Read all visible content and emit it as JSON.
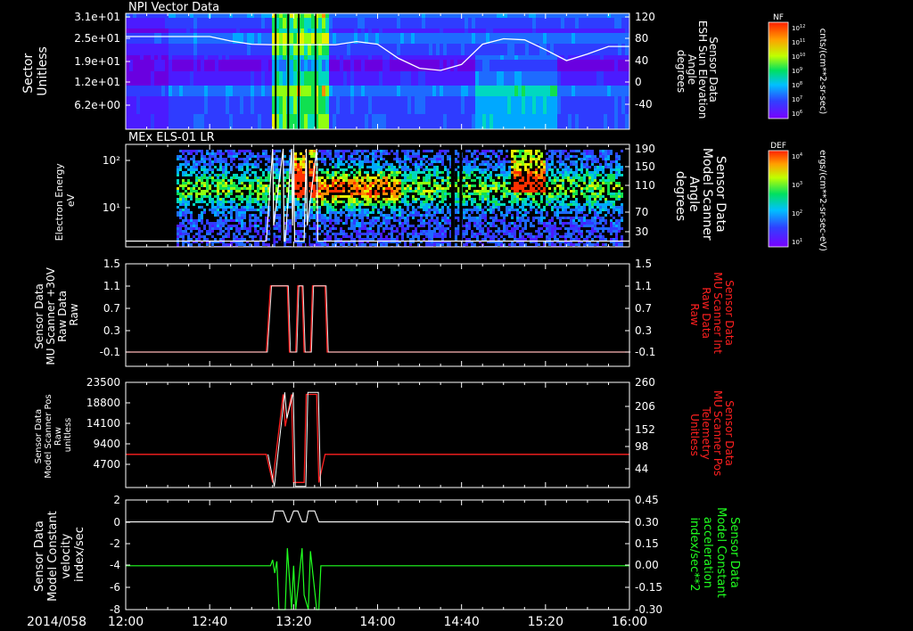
{
  "date_label": "2014/058",
  "time_axis": {
    "ticks": [
      "12:00",
      "12:40",
      "13:20",
      "14:00",
      "14:40",
      "15:20",
      "16:00"
    ]
  },
  "colors": {
    "frame": "#ffffff",
    "red_series": "#ff2020",
    "green_series": "#20ff20",
    "background": "#000000"
  },
  "chart_data": [
    {
      "type": "heatmap",
      "title": "NPI Vector Data",
      "ylabel_left": [
        "Sector",
        "Unitless"
      ],
      "left_ticks": [
        "3.1e+01",
        "2.5e+01",
        "1.9e+01",
        "1.2e+01",
        "6.2e+00"
      ],
      "right_ticks": [
        "120",
        "80",
        "40",
        "0",
        "-40"
      ],
      "ylabel_right": [
        "Sensor Data",
        "ESH Sun Elevation",
        "Angle",
        "degrees"
      ],
      "overlay_series": {
        "name": "Sun Elevation Angle",
        "color": "#ffffff",
        "x_min": [
          0,
          10,
          20,
          30,
          40,
          50,
          60,
          70,
          80,
          90,
          100,
          110,
          120,
          130,
          140,
          150,
          160,
          170,
          180,
          190,
          200,
          210,
          220,
          230,
          240
        ],
        "y_deg": [
          84,
          84,
          84,
          84,
          84,
          76,
          70,
          69,
          69,
          69,
          69,
          75,
          70,
          44,
          26,
          22,
          33,
          70,
          80,
          78,
          60,
          40,
          52,
          66,
          66
        ]
      },
      "colorbar": {
        "title": "NF",
        "tick_labels": [
          "10^12",
          "10^11",
          "10^10",
          "10^9",
          "10^8",
          "10^7",
          "10^6"
        ],
        "units": "cnts/(cm**2-sr-sec)"
      }
    },
    {
      "type": "heatmap",
      "title": "MEx ELS-01 LR",
      "ylabel_left": [
        "Electron Energy",
        "eV"
      ],
      "left_ticks": [
        "10²",
        "10¹"
      ],
      "right_ticks": [
        "190",
        "150",
        "110",
        "70",
        "30"
      ],
      "ylabel_right": [
        "Sensor Data",
        "Model Scanner",
        "Angle",
        "degrees"
      ],
      "overlay_series": {
        "name": "Model Scanner Angle",
        "color": "#ffffff",
        "baseline_deg": 12,
        "max_deg": 190
      },
      "colorbar": {
        "title": "DEF",
        "tick_labels": [
          "10^4",
          "10^3",
          "10^2",
          "10^1"
        ],
        "units": "ergs/(cm**2-sr-sec-eV)"
      }
    },
    {
      "type": "line",
      "ylabel_left": [
        "Sensor Data",
        "MU Scanner +30V",
        "Raw Data",
        "Raw"
      ],
      "left_ticks": [
        "1.5",
        "1.1",
        "0.7",
        "0.3",
        "-0.1"
      ],
      "right_ticks": [
        "1.5",
        "1.1",
        "0.7",
        "0.3",
        "-0.1"
      ],
      "ylabel_right": [
        "Sensor Data",
        "MU Scanner Int",
        "Raw Data",
        "Raw"
      ],
      "ylim": [
        -0.3,
        1.5
      ],
      "series": [
        {
          "name": "MU Scanner Int Raw Data",
          "color": "#ff2020",
          "x": [
            0,
            67,
            69,
            77,
            78,
            81,
            82,
            84,
            85,
            88,
            89,
            95,
            96,
            240
          ],
          "y": [
            0,
            0,
            1,
            1,
            0,
            0,
            1,
            1,
            0,
            0,
            1,
            1,
            0,
            0
          ]
        }
      ],
      "companion_series": {
        "color": "#ffffff",
        "x": [
          0,
          67,
          69,
          77,
          78,
          81,
          82,
          84,
          85,
          88,
          89,
          95,
          96,
          240
        ],
        "y": [
          0,
          0,
          1,
          1,
          0,
          0,
          1,
          1,
          0,
          0,
          1,
          1,
          0,
          0
        ]
      }
    },
    {
      "type": "line",
      "ylabel_left": [
        "Sensor Data",
        "Model Scanner Pos",
        "Raw",
        "unitless"
      ],
      "left_ticks": [
        "23500",
        "18800",
        "14100",
        "9400",
        "4700"
      ],
      "right_ticks": [
        "260",
        "206",
        "152",
        "98",
        "44"
      ],
      "ylabel_right": [
        "Sensor Data",
        "MU Scanner Pos",
        "Telemetry",
        "Unitless"
      ],
      "ylim_left": [
        0,
        23500
      ],
      "ylim_right": [
        -10,
        260
      ],
      "series": [
        {
          "name": "MU Scanner Pos Telemetry",
          "color": "#ff2020",
          "x": [
            0,
            67,
            70,
            75,
            76,
            79,
            80,
            85,
            86,
            91,
            92,
            95,
            240
          ],
          "y": [
            80,
            80,
            10,
            230,
            150,
            230,
            10,
            10,
            230,
            230,
            10,
            80,
            80
          ]
        }
      ],
      "companion_series": {
        "color": "#ffffff",
        "x": [
          67,
          70,
          75,
          76,
          79,
          80,
          85,
          86,
          91,
          92
        ],
        "y": [
          80,
          0,
          235,
          170,
          235,
          0,
          0,
          235,
          235,
          0
        ]
      }
    },
    {
      "type": "line",
      "ylabel_left": [
        "Sensor Data",
        "Model Constant",
        "velocity",
        "index/sec"
      ],
      "left_ticks": [
        "2",
        "0",
        "-2",
        "-4",
        "-6",
        "-8"
      ],
      "right_ticks": [
        "0.45",
        "0.30",
        "0.15",
        "0.00",
        "-0.15",
        "-0.30"
      ],
      "ylabel_right": [
        "Sensor Data",
        "Model Constant",
        "acceleration",
        "index/sec**2"
      ],
      "ylim_left": [
        -8,
        2
      ],
      "ylim_right": [
        -0.3,
        0.45
      ],
      "series": [
        {
          "name": "Model Constant velocity",
          "color": "#ffffff",
          "x": [
            0,
            70,
            71,
            73,
            75,
            77,
            78,
            80,
            82,
            84,
            86,
            87,
            89,
            90,
            92,
            240
          ],
          "y": [
            0,
            0,
            1,
            1,
            1,
            0,
            0,
            1,
            1,
            0,
            0,
            1,
            1,
            1,
            0,
            0
          ]
        },
        {
          "name": "Model Constant acceleration",
          "color": "#20ff20",
          "x": [
            0,
            69,
            70,
            71,
            72,
            73,
            76,
            77,
            79,
            80,
            81,
            84,
            85,
            87,
            88,
            91,
            92,
            93,
            240
          ],
          "y": [
            0,
            0,
            0.04,
            -0.05,
            0.03,
            -0.3,
            -0.3,
            0.12,
            -0.3,
            0.0,
            -0.3,
            0.12,
            -0.2,
            -0.3,
            0.1,
            -0.3,
            -0.3,
            0,
            0
          ]
        }
      ]
    }
  ]
}
